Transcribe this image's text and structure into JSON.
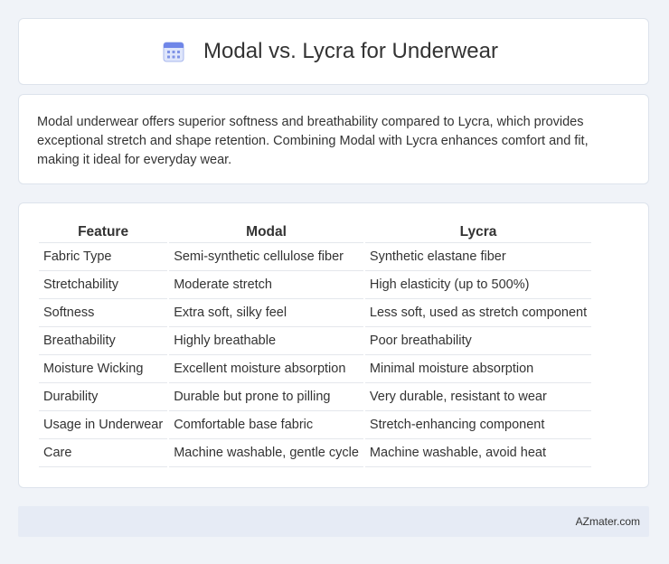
{
  "header": {
    "title": "Modal vs. Lycra for Underwear",
    "icon": "calendar-icon"
  },
  "summary": {
    "text": "Modal underwear offers superior softness and breathability compared to Lycra, which provides exceptional stretch and shape retention. Combining Modal with Lycra enhances comfort and fit, making it ideal for everyday wear."
  },
  "table": {
    "headers": [
      "Feature",
      "Modal",
      "Lycra"
    ],
    "rows": [
      [
        "Fabric Type",
        "Semi-synthetic cellulose fiber",
        "Synthetic elastane fiber"
      ],
      [
        "Stretchability",
        "Moderate stretch",
        "High elasticity (up to 500%)"
      ],
      [
        "Softness",
        "Extra soft, silky feel",
        "Less soft, used as stretch component"
      ],
      [
        "Breathability",
        "Highly breathable",
        "Poor breathability"
      ],
      [
        "Moisture Wicking",
        "Excellent moisture absorption",
        "Minimal moisture absorption"
      ],
      [
        "Durability",
        "Durable but prone to pilling",
        "Very durable, resistant to wear"
      ],
      [
        "Usage in Underwear",
        "Comfortable base fabric",
        "Stretch-enhancing component"
      ],
      [
        "Care",
        "Machine washable, gentle cycle",
        "Machine washable, avoid heat"
      ]
    ]
  },
  "footer": {
    "text": "AZmater.com"
  }
}
